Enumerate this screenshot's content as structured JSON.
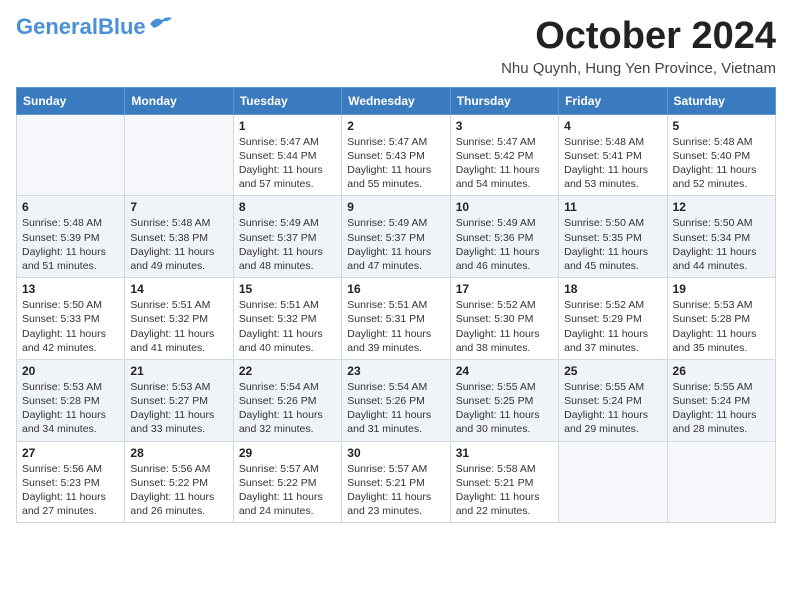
{
  "header": {
    "logo_general": "General",
    "logo_blue": "Blue",
    "month_title": "October 2024",
    "location": "Nhu Quynh, Hung Yen Province, Vietnam"
  },
  "weekdays": [
    "Sunday",
    "Monday",
    "Tuesday",
    "Wednesday",
    "Thursday",
    "Friday",
    "Saturday"
  ],
  "weeks": [
    [
      {
        "day": "",
        "sunrise": "",
        "sunset": "",
        "daylight": ""
      },
      {
        "day": "",
        "sunrise": "",
        "sunset": "",
        "daylight": ""
      },
      {
        "day": "1",
        "sunrise": "Sunrise: 5:47 AM",
        "sunset": "Sunset: 5:44 PM",
        "daylight": "Daylight: 11 hours and 57 minutes."
      },
      {
        "day": "2",
        "sunrise": "Sunrise: 5:47 AM",
        "sunset": "Sunset: 5:43 PM",
        "daylight": "Daylight: 11 hours and 55 minutes."
      },
      {
        "day": "3",
        "sunrise": "Sunrise: 5:47 AM",
        "sunset": "Sunset: 5:42 PM",
        "daylight": "Daylight: 11 hours and 54 minutes."
      },
      {
        "day": "4",
        "sunrise": "Sunrise: 5:48 AM",
        "sunset": "Sunset: 5:41 PM",
        "daylight": "Daylight: 11 hours and 53 minutes."
      },
      {
        "day": "5",
        "sunrise": "Sunrise: 5:48 AM",
        "sunset": "Sunset: 5:40 PM",
        "daylight": "Daylight: 11 hours and 52 minutes."
      }
    ],
    [
      {
        "day": "6",
        "sunrise": "Sunrise: 5:48 AM",
        "sunset": "Sunset: 5:39 PM",
        "daylight": "Daylight: 11 hours and 51 minutes."
      },
      {
        "day": "7",
        "sunrise": "Sunrise: 5:48 AM",
        "sunset": "Sunset: 5:38 PM",
        "daylight": "Daylight: 11 hours and 49 minutes."
      },
      {
        "day": "8",
        "sunrise": "Sunrise: 5:49 AM",
        "sunset": "Sunset: 5:37 PM",
        "daylight": "Daylight: 11 hours and 48 minutes."
      },
      {
        "day": "9",
        "sunrise": "Sunrise: 5:49 AM",
        "sunset": "Sunset: 5:37 PM",
        "daylight": "Daylight: 11 hours and 47 minutes."
      },
      {
        "day": "10",
        "sunrise": "Sunrise: 5:49 AM",
        "sunset": "Sunset: 5:36 PM",
        "daylight": "Daylight: 11 hours and 46 minutes."
      },
      {
        "day": "11",
        "sunrise": "Sunrise: 5:50 AM",
        "sunset": "Sunset: 5:35 PM",
        "daylight": "Daylight: 11 hours and 45 minutes."
      },
      {
        "day": "12",
        "sunrise": "Sunrise: 5:50 AM",
        "sunset": "Sunset: 5:34 PM",
        "daylight": "Daylight: 11 hours and 44 minutes."
      }
    ],
    [
      {
        "day": "13",
        "sunrise": "Sunrise: 5:50 AM",
        "sunset": "Sunset: 5:33 PM",
        "daylight": "Daylight: 11 hours and 42 minutes."
      },
      {
        "day": "14",
        "sunrise": "Sunrise: 5:51 AM",
        "sunset": "Sunset: 5:32 PM",
        "daylight": "Daylight: 11 hours and 41 minutes."
      },
      {
        "day": "15",
        "sunrise": "Sunrise: 5:51 AM",
        "sunset": "Sunset: 5:32 PM",
        "daylight": "Daylight: 11 hours and 40 minutes."
      },
      {
        "day": "16",
        "sunrise": "Sunrise: 5:51 AM",
        "sunset": "Sunset: 5:31 PM",
        "daylight": "Daylight: 11 hours and 39 minutes."
      },
      {
        "day": "17",
        "sunrise": "Sunrise: 5:52 AM",
        "sunset": "Sunset: 5:30 PM",
        "daylight": "Daylight: 11 hours and 38 minutes."
      },
      {
        "day": "18",
        "sunrise": "Sunrise: 5:52 AM",
        "sunset": "Sunset: 5:29 PM",
        "daylight": "Daylight: 11 hours and 37 minutes."
      },
      {
        "day": "19",
        "sunrise": "Sunrise: 5:53 AM",
        "sunset": "Sunset: 5:28 PM",
        "daylight": "Daylight: 11 hours and 35 minutes."
      }
    ],
    [
      {
        "day": "20",
        "sunrise": "Sunrise: 5:53 AM",
        "sunset": "Sunset: 5:28 PM",
        "daylight": "Daylight: 11 hours and 34 minutes."
      },
      {
        "day": "21",
        "sunrise": "Sunrise: 5:53 AM",
        "sunset": "Sunset: 5:27 PM",
        "daylight": "Daylight: 11 hours and 33 minutes."
      },
      {
        "day": "22",
        "sunrise": "Sunrise: 5:54 AM",
        "sunset": "Sunset: 5:26 PM",
        "daylight": "Daylight: 11 hours and 32 minutes."
      },
      {
        "day": "23",
        "sunrise": "Sunrise: 5:54 AM",
        "sunset": "Sunset: 5:26 PM",
        "daylight": "Daylight: 11 hours and 31 minutes."
      },
      {
        "day": "24",
        "sunrise": "Sunrise: 5:55 AM",
        "sunset": "Sunset: 5:25 PM",
        "daylight": "Daylight: 11 hours and 30 minutes."
      },
      {
        "day": "25",
        "sunrise": "Sunrise: 5:55 AM",
        "sunset": "Sunset: 5:24 PM",
        "daylight": "Daylight: 11 hours and 29 minutes."
      },
      {
        "day": "26",
        "sunrise": "Sunrise: 5:55 AM",
        "sunset": "Sunset: 5:24 PM",
        "daylight": "Daylight: 11 hours and 28 minutes."
      }
    ],
    [
      {
        "day": "27",
        "sunrise": "Sunrise: 5:56 AM",
        "sunset": "Sunset: 5:23 PM",
        "daylight": "Daylight: 11 hours and 27 minutes."
      },
      {
        "day": "28",
        "sunrise": "Sunrise: 5:56 AM",
        "sunset": "Sunset: 5:22 PM",
        "daylight": "Daylight: 11 hours and 26 minutes."
      },
      {
        "day": "29",
        "sunrise": "Sunrise: 5:57 AM",
        "sunset": "Sunset: 5:22 PM",
        "daylight": "Daylight: 11 hours and 24 minutes."
      },
      {
        "day": "30",
        "sunrise": "Sunrise: 5:57 AM",
        "sunset": "Sunset: 5:21 PM",
        "daylight": "Daylight: 11 hours and 23 minutes."
      },
      {
        "day": "31",
        "sunrise": "Sunrise: 5:58 AM",
        "sunset": "Sunset: 5:21 PM",
        "daylight": "Daylight: 11 hours and 22 minutes."
      },
      {
        "day": "",
        "sunrise": "",
        "sunset": "",
        "daylight": ""
      },
      {
        "day": "",
        "sunrise": "",
        "sunset": "",
        "daylight": ""
      }
    ]
  ]
}
